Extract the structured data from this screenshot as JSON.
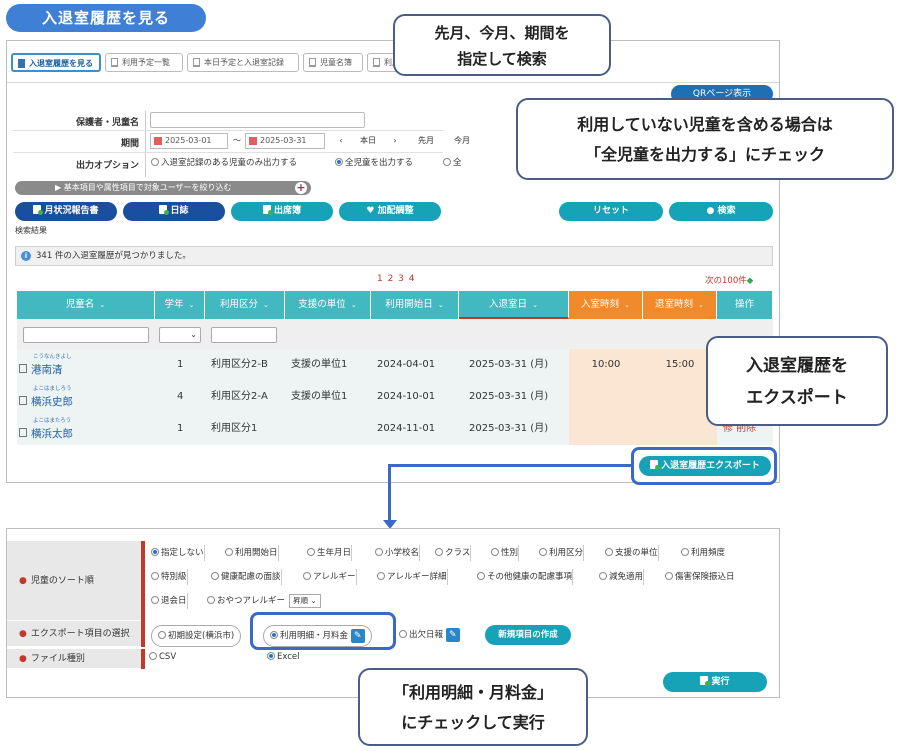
{
  "page_title": "入退室履歴を見る",
  "tabs": [
    {
      "label": "入退室履歴を見る",
      "active": true
    },
    {
      "label": "利用予定一覧",
      "active": false
    },
    {
      "label": "本日予定と入退室記録",
      "active": false
    },
    {
      "label": "児童名簿",
      "active": false
    },
    {
      "label": "利用",
      "active": false
    }
  ],
  "qr_button": "QRページ表示",
  "form": {
    "guardian_label": "保護者・児童名",
    "period_label": "期間",
    "date_from": "2025-03-01",
    "tilde": "〜",
    "date_to": "2025-03-31",
    "prev": "‹",
    "today": "本日",
    "next": "›",
    "last_month": "先月",
    "this_month": "今月",
    "output_label": "出力オプション",
    "opt_with_records": "入退室記録のある児童のみ出力する",
    "opt_all": "全児童を出力する",
    "opt_third": "全"
  },
  "filter_bar": "▶ 基本項目や属性項目で対象ユーザーを絞り込む",
  "plus": "+",
  "buttons": {
    "monthly_report": "月状況報告書",
    "diary": "日誌",
    "attendance": "出席簿",
    "bonus": "加配調整",
    "reset": "リセット",
    "search": "検索",
    "search_icon": "●",
    "bonus_icon": "♥"
  },
  "result_label": "検索結果",
  "found_text": "341 件の入退室履歴が見つかりました。",
  "info_icon": "i",
  "pager": "1 2 3 4",
  "next100": "次の100件",
  "next100_arrow": "◆",
  "table": {
    "headers": [
      "児童名",
      "学年",
      "利用区分",
      "支援の単位",
      "利用開始日",
      "入退室日",
      "入室時刻",
      "退室時刻",
      "操作"
    ],
    "header_chevron": "⌄",
    "filter_dropdown": "⌄",
    "rows": [
      {
        "kana": "こうなんきよし",
        "name": "港南清",
        "grade": "1",
        "category": "利用区分2-B",
        "unit": "支援の単位1",
        "start": "2024-04-01",
        "date": "2025-03-31 (月)",
        "in": "10:00",
        "out": "15:00",
        "op": ""
      },
      {
        "kana": "よこはましろう",
        "name": "横浜史郎",
        "grade": "4",
        "category": "利用区分2-A",
        "unit": "支援の単位1",
        "start": "2024-10-01",
        "date": "2025-03-31 (月)",
        "in": "",
        "out": "",
        "op": ""
      },
      {
        "kana": "よこはまたろう",
        "name": "横浜太郎",
        "grade": "1",
        "category": "利用区分1",
        "unit": "",
        "start": "2024-11-01",
        "date": "2025-03-31 (月)",
        "in": "",
        "out": "",
        "op": "修 削除"
      }
    ]
  },
  "export_button": "入退室履歴エクスポート",
  "callouts": {
    "search": [
      "先月、今月、期間を",
      "指定して検索"
    ],
    "all_children": [
      "利用していない児童を含める場合は",
      "「全児童を出力する」にチェック"
    ],
    "export": [
      "入退室履歴を",
      "エクスポート"
    ],
    "billing": [
      "「利用明細・月料金」",
      "にチェックして実行"
    ]
  },
  "export_panel": {
    "sort_label": "児童のソート順",
    "sort_options": [
      {
        "label": "指定しない",
        "checked": true
      },
      {
        "label": "利用開始日",
        "checked": false
      },
      {
        "label": "生年月日",
        "checked": false
      },
      {
        "label": "小学校名",
        "checked": false
      },
      {
        "label": "クラス",
        "checked": false
      },
      {
        "label": "性別",
        "checked": false
      },
      {
        "label": "利用区分",
        "checked": false
      },
      {
        "label": "支援の単位",
        "checked": false
      },
      {
        "label": "利用頻度",
        "checked": false
      },
      {
        "label": "特別級",
        "checked": false
      },
      {
        "label": "健康配慮の面談",
        "checked": false
      },
      {
        "label": "アレルギー",
        "checked": false
      },
      {
        "label": "アレルギー詳細",
        "checked": false
      },
      {
        "label": "その他健康の配慮事項",
        "checked": false
      },
      {
        "label": "減免適用",
        "checked": false
      },
      {
        "label": "傷害保険振込日",
        "checked": false
      },
      {
        "label": "退会日",
        "checked": false
      },
      {
        "label": "おやつアレルギー",
        "checked": false
      }
    ],
    "sort_order": "昇順 ⌄",
    "item_label": "エクスポート項目の選択",
    "item_options": [
      {
        "label": "初期設定(横浜市)",
        "checked": false
      },
      {
        "label": "利用明細・月料金",
        "checked": true
      },
      {
        "label": "出欠日報",
        "checked": false
      }
    ],
    "pen_icon": "✎",
    "new_item": "新規項目の作成",
    "file_label": "ファイル種別",
    "file_options": [
      {
        "label": "CSV",
        "checked": false
      },
      {
        "label": "Excel",
        "checked": true
      }
    ],
    "run": "実行"
  }
}
